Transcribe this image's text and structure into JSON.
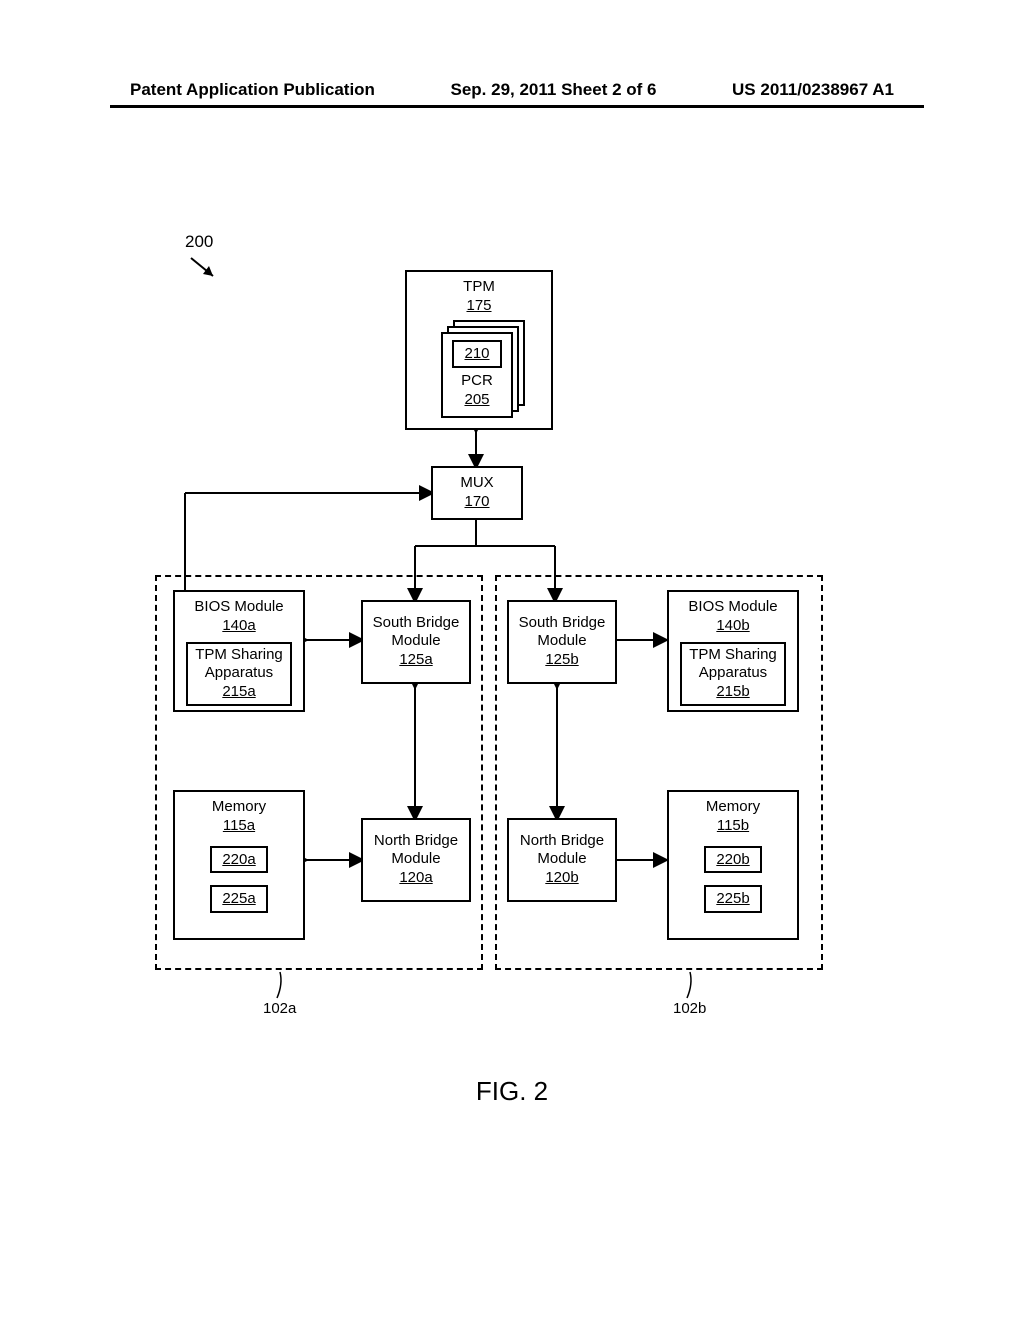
{
  "header": {
    "left": "Patent Application Publication",
    "mid": "Sep. 29, 2011  Sheet 2 of 6",
    "right": "US 2011/0238967 A1"
  },
  "fig_ref": "200",
  "tpm": {
    "title": "TPM",
    "num": "175"
  },
  "pcr": {
    "inner": "210",
    "title": "PCR",
    "num": "205"
  },
  "mux": {
    "title": "MUX",
    "num": "170"
  },
  "zoneA": {
    "bios": {
      "title": "BIOS Module",
      "num": "140a"
    },
    "share": {
      "title": "TPM Sharing\nApparatus",
      "num": "215a"
    },
    "south": {
      "title": "South Bridge\nModule",
      "num": "125a"
    },
    "north": {
      "title": "North Bridge\nModule",
      "num": "120a"
    },
    "mem": {
      "title": "Memory",
      "num": "115a",
      "r1": "220a",
      "r2": "225a"
    },
    "label": "102a"
  },
  "zoneB": {
    "bios": {
      "title": "BIOS Module",
      "num": "140b"
    },
    "share": {
      "title": "TPM Sharing\nApparatus",
      "num": "215b"
    },
    "south": {
      "title": "South Bridge\nModule",
      "num": "125b"
    },
    "north": {
      "title": "North Bridge\nModule",
      "num": "120b"
    },
    "mem": {
      "title": "Memory",
      "num": "115b",
      "r1": "220b",
      "r2": "225b"
    },
    "label": "102b"
  },
  "caption": "FIG. 2"
}
